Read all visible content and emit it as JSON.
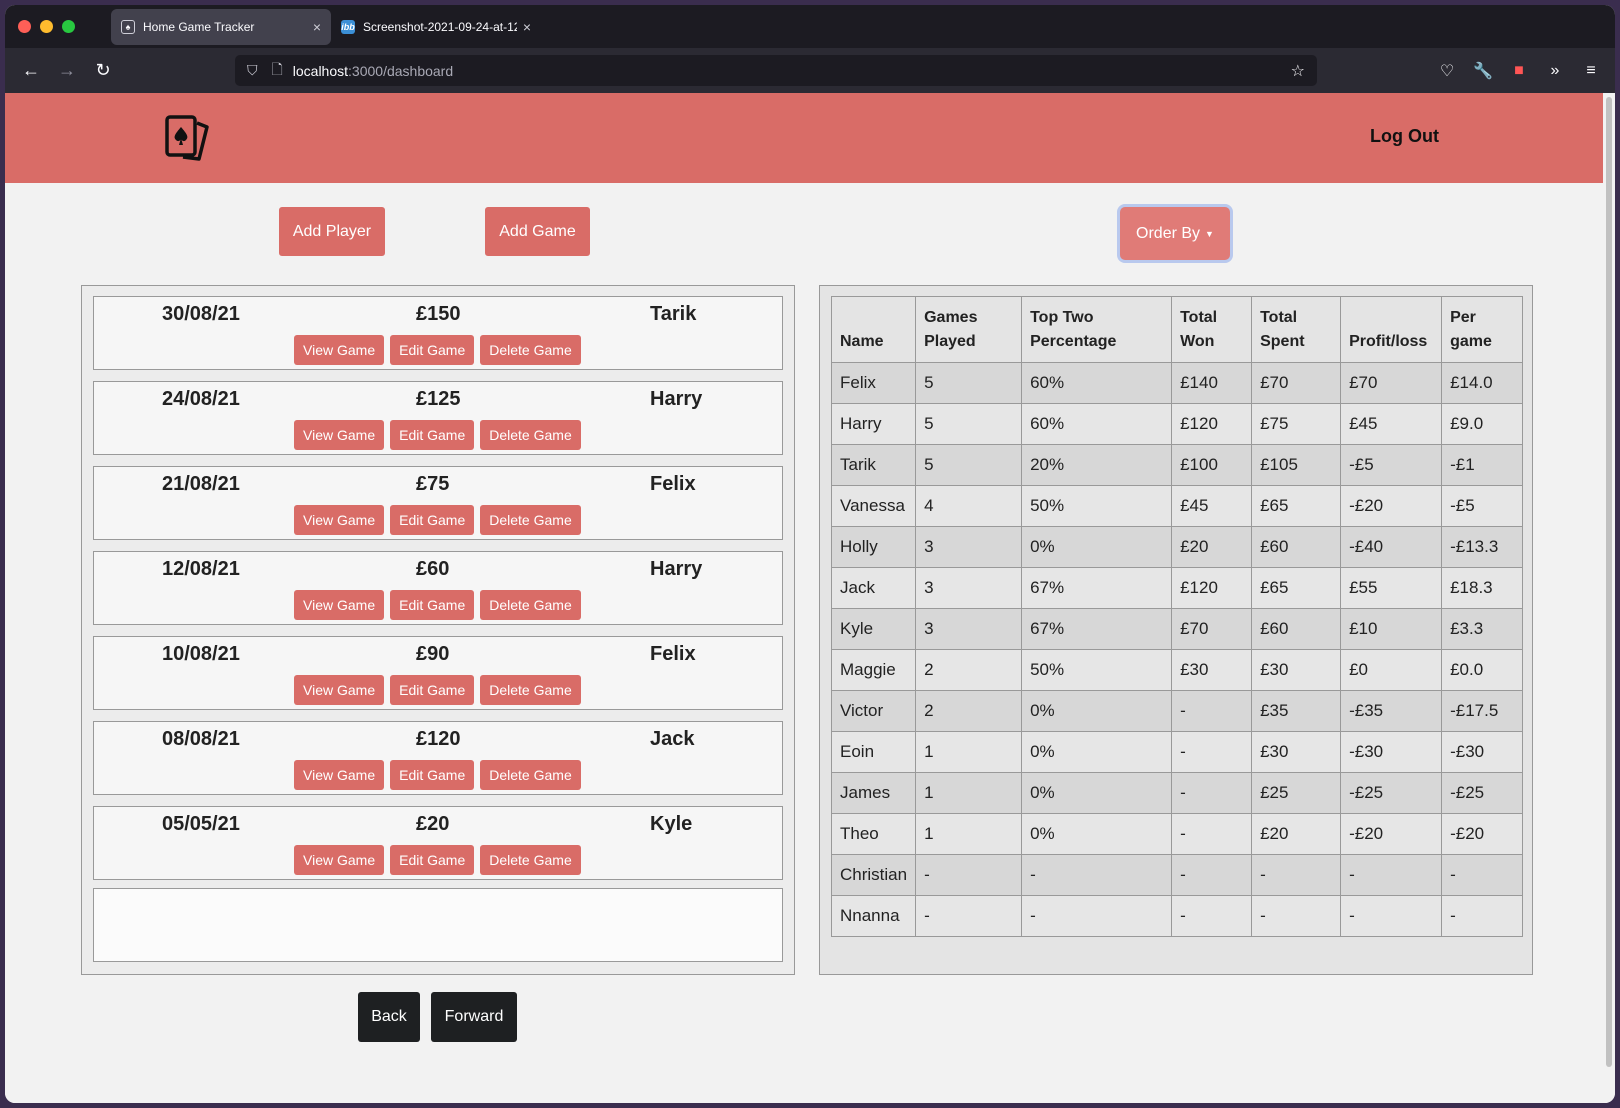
{
  "browser": {
    "tabs": [
      {
        "title": "Home Game Tracker",
        "active": true,
        "close": "×"
      },
      {
        "title": "Screenshot-2021-09-24-at-12-",
        "active": false,
        "close": "×",
        "favicon_text": "ibb"
      }
    ],
    "url": {
      "host": "localhost",
      "path": ":3000/dashboard"
    },
    "icons": [
      "back-icon",
      "forward-icon",
      "reload-icon",
      "shield-icon",
      "page-icon",
      "star-icon",
      "pocket-icon",
      "wrench-icon",
      "extension-icon",
      "overflow-icon",
      "menu-icon"
    ]
  },
  "header": {
    "logout": "Log Out",
    "accent_color": "#d96c67"
  },
  "toolbar": {
    "add_player": "Add Player",
    "add_game": "Add Game",
    "order_by": "Order By"
  },
  "games": [
    {
      "date": "30/08/21",
      "amount": "£150",
      "winner": "Tarik"
    },
    {
      "date": "24/08/21",
      "amount": "£125",
      "winner": "Harry"
    },
    {
      "date": "21/08/21",
      "amount": "£75",
      "winner": "Felix"
    },
    {
      "date": "12/08/21",
      "amount": "£60",
      "winner": "Harry"
    },
    {
      "date": "10/08/21",
      "amount": "£90",
      "winner": "Felix"
    },
    {
      "date": "08/08/21",
      "amount": "£120",
      "winner": "Jack"
    },
    {
      "date": "05/05/21",
      "amount": "£20",
      "winner": "Kyle"
    }
  ],
  "game_actions": {
    "view": "View Game",
    "edit": "Edit Game",
    "delete": "Delete Game"
  },
  "pagination": {
    "back": "Back",
    "forward": "Forward"
  },
  "stats": {
    "headers": [
      [
        "Name"
      ],
      [
        "Games",
        "Played"
      ],
      [
        "Top Two",
        "Percentage"
      ],
      [
        "Total",
        "Won"
      ],
      [
        "Total",
        "Spent"
      ],
      [
        "Profit/loss"
      ],
      [
        "Per",
        "game"
      ]
    ],
    "rows": [
      [
        "Felix",
        "5",
        "60%",
        "£140",
        "£70",
        "£70",
        "£14.0"
      ],
      [
        "Harry",
        "5",
        "60%",
        "£120",
        "£75",
        "£45",
        "£9.0"
      ],
      [
        "Tarik",
        "5",
        "20%",
        "£100",
        "£105",
        "-£5",
        "-£1"
      ],
      [
        "Vanessa",
        "4",
        "50%",
        "£45",
        "£65",
        "-£20",
        "-£5"
      ],
      [
        "Holly",
        "3",
        "0%",
        "£20",
        "£60",
        "-£40",
        "-£13.3"
      ],
      [
        "Jack",
        "3",
        "67%",
        "£120",
        "£65",
        "£55",
        "£18.3"
      ],
      [
        "Kyle",
        "3",
        "67%",
        "£70",
        "£60",
        "£10",
        "£3.3"
      ],
      [
        "Maggie",
        "2",
        "50%",
        "£30",
        "£30",
        "£0",
        "£0.0"
      ],
      [
        "Victor",
        "2",
        "0%",
        "-",
        "£35",
        "-£35",
        "-£17.5"
      ],
      [
        "Eoin",
        "1",
        "0%",
        "-",
        "£30",
        "-£30",
        "-£30"
      ],
      [
        "James",
        "1",
        "0%",
        "-",
        "£25",
        "-£25",
        "-£25"
      ],
      [
        "Theo",
        "1",
        "0%",
        "-",
        "£20",
        "-£20",
        "-£20"
      ],
      [
        "Christian",
        "-",
        "-",
        "-",
        "-",
        "-",
        "-"
      ],
      [
        "Nnanna",
        "-",
        "-",
        "-",
        "-",
        "-",
        "-"
      ]
    ]
  }
}
